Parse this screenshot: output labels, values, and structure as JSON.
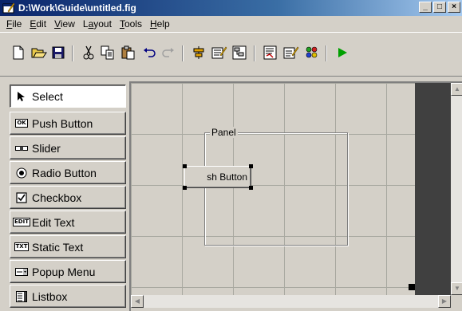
{
  "window": {
    "title": "D:\\Work\\Guide\\untitled.fig",
    "controls": [
      "_",
      "□",
      "×"
    ]
  },
  "menu": [
    {
      "label": "File",
      "key": "F",
      "rest": "ile"
    },
    {
      "label": "Edit",
      "key": "E",
      "rest": "dit"
    },
    {
      "label": "View",
      "key": "V",
      "rest": "iew"
    },
    {
      "label": "Layout",
      "key": "a",
      "prefix": "L",
      "rest": "yout"
    },
    {
      "label": "Tools",
      "key": "T",
      "rest": "ools"
    },
    {
      "label": "Help",
      "key": "H",
      "rest": "elp"
    }
  ],
  "toolbar": {
    "icons": [
      "new-file-icon",
      "open-folder-icon",
      "save-icon",
      "cut-icon",
      "copy-icon",
      "paste-icon",
      "undo-icon",
      "redo-icon",
      "align-icon",
      "menu-editor-icon",
      "tab-order-icon",
      "m-file-editor-icon",
      "property-inspector-icon",
      "object-browser-icon",
      "run-icon"
    ]
  },
  "palette": {
    "items": [
      {
        "label": "Select",
        "icon": "arrow-pointer-icon",
        "selected": true
      },
      {
        "label": "Push Button",
        "icon": "push-button-icon",
        "chip": "OK"
      },
      {
        "label": "Slider",
        "icon": "slider-icon"
      },
      {
        "label": "Radio Button",
        "icon": "radio-button-icon"
      },
      {
        "label": "Checkbox",
        "icon": "checkbox-icon"
      },
      {
        "label": "Edit Text",
        "icon": "edit-text-icon",
        "chip": "EDIT"
      },
      {
        "label": "Static Text",
        "icon": "static-text-icon",
        "chip": "TXT"
      },
      {
        "label": "Popup Menu",
        "icon": "popup-menu-icon"
      },
      {
        "label": "Listbox",
        "icon": "listbox-icon"
      }
    ]
  },
  "canvas": {
    "panel_title": "Panel",
    "button_label": "sh Button"
  },
  "colors": {
    "face": "#d4d0c8",
    "title_start": "#0a246a",
    "title_end": "#a6caf0",
    "run_green": "#00a000",
    "dark_margin": "#404040"
  }
}
